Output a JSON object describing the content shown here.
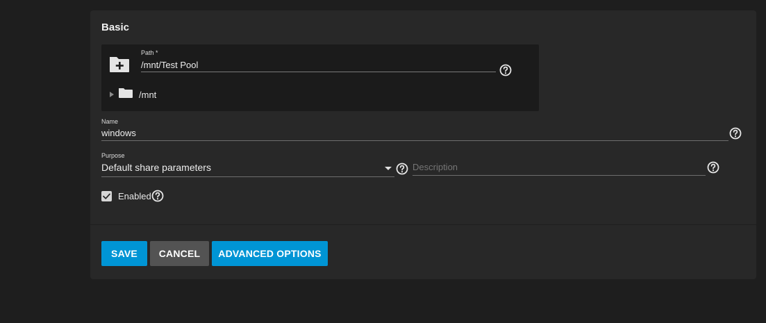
{
  "section": {
    "title": "Basic"
  },
  "path": {
    "label": "Path *",
    "value": "/mnt/Test Pool",
    "tree_root": "/mnt"
  },
  "name": {
    "label": "Name",
    "value": "windows"
  },
  "purpose": {
    "label": "Purpose",
    "selected": "Default share parameters"
  },
  "description": {
    "placeholder": "Description",
    "value": ""
  },
  "enabled": {
    "label": "Enabled",
    "checked": true
  },
  "actions": {
    "save": "SAVE",
    "cancel": "CANCEL",
    "advanced": "ADVANCED OPTIONS"
  },
  "icons": {
    "folder_add": "folder-plus-icon",
    "folder": "folder-icon",
    "help": "help-circle-icon",
    "expand": "triangle-right-icon",
    "dropdown": "caret-down-icon",
    "check": "check-icon"
  },
  "colors": {
    "page_bg": "#1e1e1e",
    "card_bg": "#282828",
    "explorer_bg": "#1b1b1b",
    "primary": "#0095d5",
    "secondary": "#535353"
  }
}
